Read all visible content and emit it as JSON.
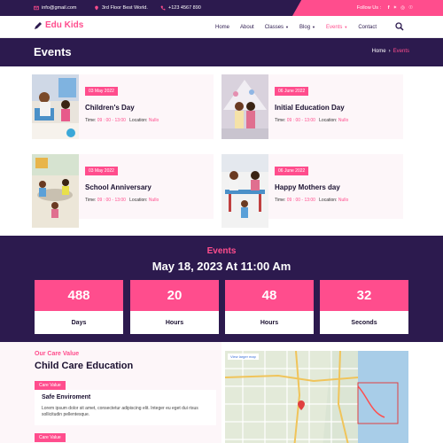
{
  "topbar": {
    "email": "info@gmail.com",
    "address": "3rd Floor Best World.",
    "phone": "+123 4567 890",
    "follow_label": "Follow Us :",
    "social": [
      "f",
      "✴",
      "◎",
      "☉"
    ]
  },
  "nav": {
    "logo": "Edu Kids",
    "menu": [
      {
        "label": "Home",
        "caret": false
      },
      {
        "label": "About",
        "caret": false
      },
      {
        "label": "Classes",
        "caret": true
      },
      {
        "label": "Blog",
        "caret": true
      },
      {
        "label": "Events",
        "caret": true,
        "active": true
      },
      {
        "label": "Contact",
        "caret": false
      }
    ]
  },
  "page_header": {
    "title": "Events",
    "crumb_home": "Home",
    "crumb_current": "Events"
  },
  "events": [
    {
      "date": "03 May 2022",
      "title": "Children's Day",
      "time_label": "Time:",
      "time": "09 : 00 - 13:00",
      "location_label": "Location:",
      "location": "Nullo"
    },
    {
      "date": "06 June 2022",
      "title": "Initial Education Day",
      "time_label": "Time:",
      "time": "09 : 00 - 13:00",
      "location_label": "Location:",
      "location": "Nullo"
    },
    {
      "date": "03 May 2022",
      "title": "School Anniversary",
      "time_label": "Time:",
      "time": "09 : 00 - 13:00",
      "location_label": "Location:",
      "location": "Nullo"
    },
    {
      "date": "06 June 2022",
      "title": "Happy Mothers day",
      "time_label": "Time:",
      "time": "09 : 00 - 13:00",
      "location_label": "Location:",
      "location": "Nullo"
    }
  ],
  "countdown": {
    "label": "Events",
    "date": "May 18, 2023 At 11:00 Am",
    "boxes": [
      {
        "value": "488",
        "unit": "Days"
      },
      {
        "value": "20",
        "unit": "Hours"
      },
      {
        "value": "48",
        "unit": "Hours"
      },
      {
        "value": "32",
        "unit": "Seconds"
      }
    ]
  },
  "care": {
    "eyebrow": "Our Care Value",
    "title": "Child Care Education",
    "tag1": "Care Value",
    "value_title": "Safe Enviroment",
    "value_desc": "Lorem ipsum dolor sit amet, consectetur adipiscing elit. Integer eu eget dui risus sollicitudin pellentesque.",
    "tag2": "Care Value",
    "map_link": "View larger map"
  },
  "colors": {
    "primary": "#2c1a4e",
    "accent": "#ff4d8d"
  }
}
